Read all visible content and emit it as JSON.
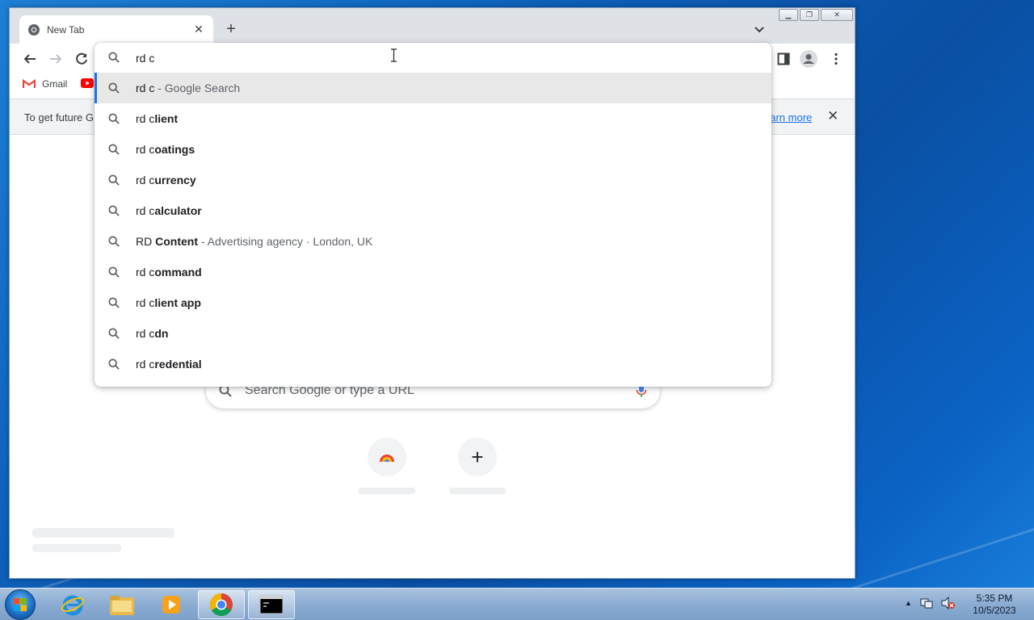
{
  "tab": {
    "title": "New Tab"
  },
  "omnibox": {
    "value": "rd c",
    "suggestions": [
      {
        "prefix": "rd c",
        "bold": "",
        "desc": " - Google Search"
      },
      {
        "prefix": "rd c",
        "bold": "lient",
        "desc": ""
      },
      {
        "prefix": "rd c",
        "bold": "oatings",
        "desc": ""
      },
      {
        "prefix": "rd c",
        "bold": "urrency",
        "desc": ""
      },
      {
        "prefix": "rd c",
        "bold": "alculator",
        "desc": ""
      },
      {
        "prefix": "RD ",
        "bold": "Content",
        "desc": " - Advertising agency · London, UK"
      },
      {
        "prefix": "rd c",
        "bold": "ommand",
        "desc": ""
      },
      {
        "prefix": "rd c",
        "bold": "lient app",
        "desc": ""
      },
      {
        "prefix": "rd c",
        "bold": "dn",
        "desc": ""
      },
      {
        "prefix": "rd c",
        "bold": "redential",
        "desc": ""
      }
    ]
  },
  "bookmarks": {
    "gmail": "Gmail"
  },
  "infobar": {
    "message": "To get future G",
    "learn_more": "earn more"
  },
  "ntp": {
    "search_placeholder": "Search Google or type a URL",
    "add_shortcut": "+"
  },
  "taskbar": {
    "time": "5:35 PM",
    "date": "10/5/2023"
  },
  "colors": {
    "accent": "#1a73e8",
    "selected_row": "#e8e8e9"
  }
}
